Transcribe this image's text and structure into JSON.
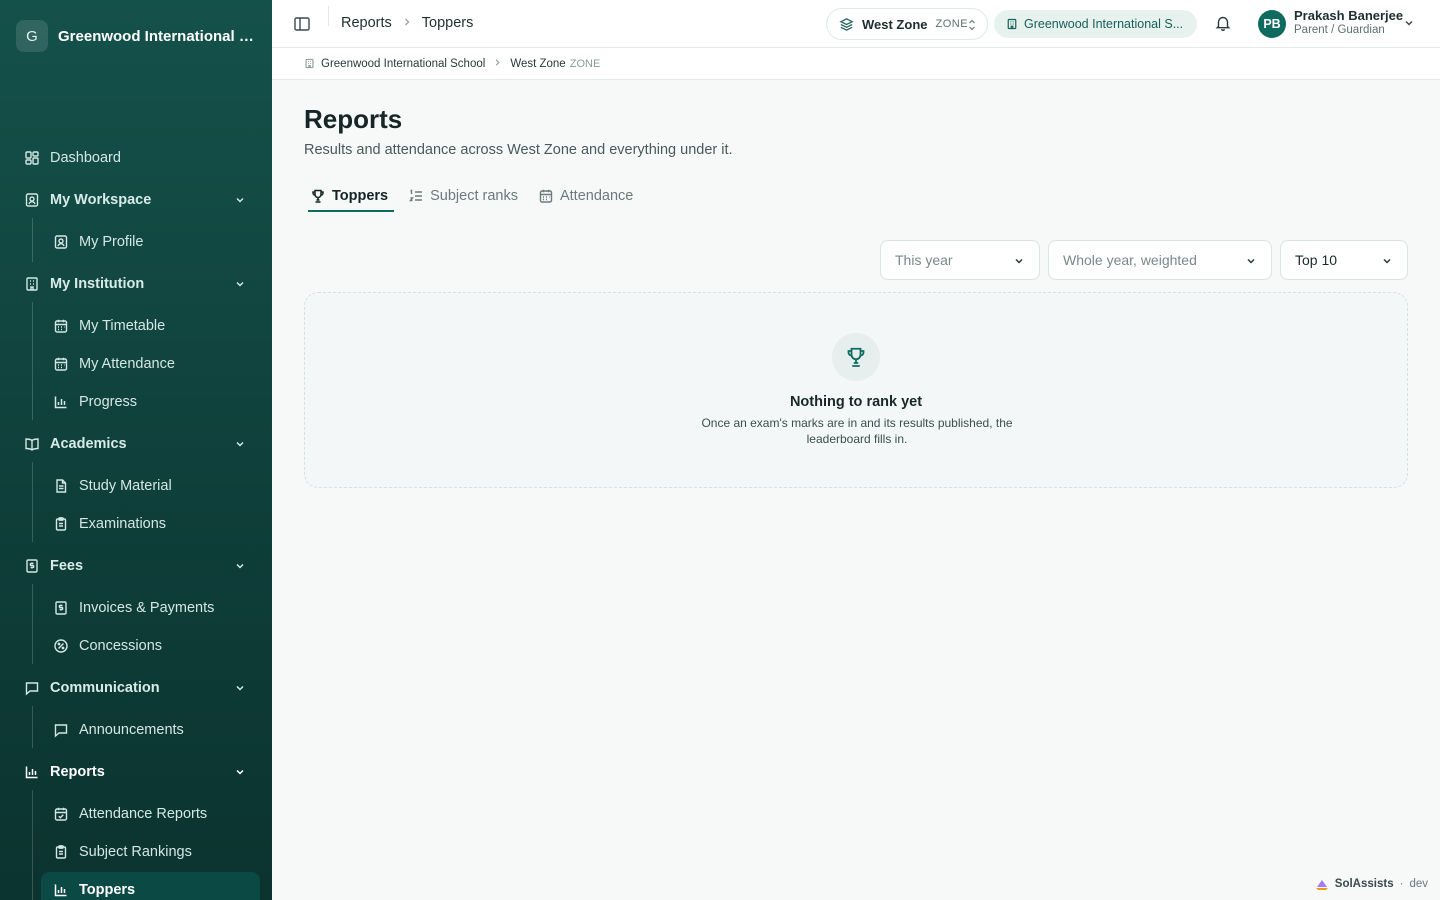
{
  "sidebar": {
    "logo_letter": "G",
    "brand": "Greenwood International Sc...",
    "items": {
      "dashboard": "Dashboard",
      "my_workspace": "My Workspace",
      "my_profile": "My Profile",
      "my_institution": "My Institution",
      "my_timetable": "My Timetable",
      "my_attendance": "My Attendance",
      "progress": "Progress",
      "academics": "Academics",
      "study_material": "Study Material",
      "examinations": "Examinations",
      "fees": "Fees",
      "invoices_payments": "Invoices & Payments",
      "concessions": "Concessions",
      "communication": "Communication",
      "announcements": "Announcements",
      "reports": "Reports",
      "attendance_reports": "Attendance Reports",
      "subject_rankings": "Subject Rankings",
      "toppers": "Toppers"
    }
  },
  "topbar": {
    "breadcrumb": [
      "Reports",
      "Toppers"
    ],
    "zone": {
      "name": "West Zone",
      "tag": "ZONE"
    },
    "school": "Greenwood International S...",
    "user": {
      "initials": "PB",
      "name": "Prakash Banerjee",
      "role": "Parent / Guardian"
    }
  },
  "scope": {
    "school": "Greenwood International School",
    "zone": "West Zone",
    "zone_tag": "ZONE"
  },
  "main": {
    "title": "Reports",
    "subtitle": "Results and attendance across West Zone and everything under it.",
    "tabs": [
      "Toppers",
      "Subject ranks",
      "Attendance"
    ],
    "filters": {
      "period": "This year",
      "weighting": "Whole year, weighted",
      "limit": "Top 10"
    },
    "empty": {
      "title": "Nothing to rank yet",
      "description": "Once an exam's marks are in and its results published, the leaderboard fills in."
    }
  },
  "footer": {
    "brand": "SolAssists",
    "env": "dev"
  },
  "colors": {
    "sidebar": "#15514b",
    "accent": "#0f6b5f",
    "active_item": "#0b4944"
  }
}
